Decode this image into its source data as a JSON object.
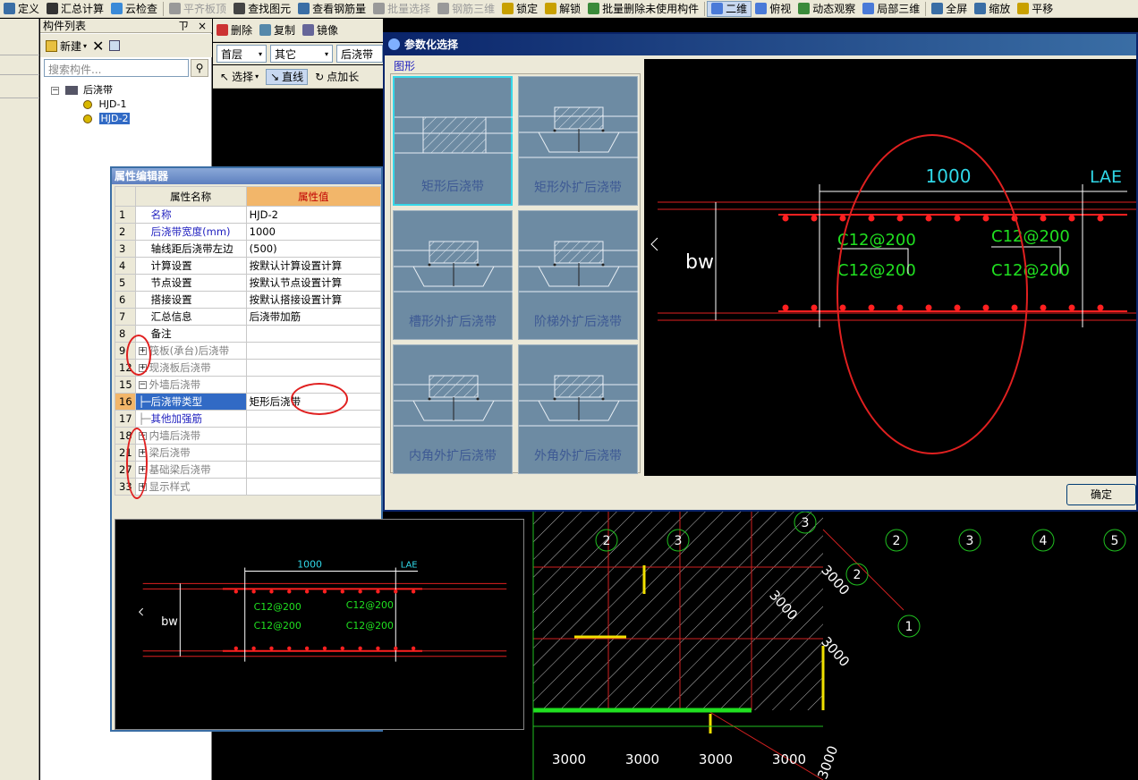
{
  "toolbar": {
    "items": [
      {
        "label": "定义",
        "icon": "define-icon",
        "disabled": false
      },
      {
        "label": "汇总计算",
        "icon": "sigma-icon",
        "disabled": false
      },
      {
        "label": "云检查",
        "icon": "cloud-check-icon",
        "disabled": false
      },
      {
        "label": "平齐板顶",
        "icon": "align-top-icon",
        "disabled": true
      },
      {
        "label": "查找图元",
        "icon": "find-icon",
        "disabled": false
      },
      {
        "label": "查看钢筋量",
        "icon": "rebar-view-icon",
        "disabled": false
      },
      {
        "label": "批量选择",
        "icon": "batch-select-icon",
        "disabled": true
      },
      {
        "label": "钢筋三维",
        "icon": "rebar-3d-icon",
        "disabled": true
      },
      {
        "label": "锁定",
        "icon": "lock-icon",
        "disabled": false
      },
      {
        "label": "解锁",
        "icon": "unlock-icon",
        "disabled": false
      },
      {
        "label": "批量删除未使用构件",
        "icon": "batch-delete-icon",
        "disabled": false
      },
      {
        "label": "二维",
        "icon": "view-2d-icon",
        "disabled": false,
        "pressed": true
      },
      {
        "label": "俯视",
        "icon": "top-view-icon",
        "disabled": false
      },
      {
        "label": "动态观察",
        "icon": "orbit-icon",
        "disabled": false
      },
      {
        "label": "局部三维",
        "icon": "local-3d-icon",
        "disabled": false
      },
      {
        "label": "全屏",
        "icon": "fullscreen-icon",
        "disabled": false
      },
      {
        "label": "缩放",
        "icon": "zoom-icon",
        "disabled": false
      },
      {
        "label": "平移",
        "icon": "pan-icon",
        "disabled": false
      }
    ]
  },
  "component_panel": {
    "title": "构件列表",
    "pin": "ㄗ",
    "close": "×",
    "new_label": "新建",
    "search_placeholder": "搜索构件...",
    "tree_root": "后浇带",
    "tree_children": [
      "HJD-1",
      "HJD-2"
    ]
  },
  "main_bars": {
    "delete_label": "删除",
    "copy_label": "复制",
    "mirror_label": "镜像",
    "floor": "首层",
    "category": "其它",
    "type": "后浇带",
    "select_label": "选择",
    "line_label": "直线",
    "point_extend_label": "点加长"
  },
  "property_editor": {
    "title": "属性编辑器",
    "col_name": "属性名称",
    "col_value": "属性值",
    "rows": [
      {
        "num": "1",
        "name": "名称",
        "value": "HJD-2",
        "style": "blue",
        "expander": ""
      },
      {
        "num": "2",
        "name": "后浇带宽度(mm)",
        "value": "1000",
        "style": "blue",
        "expander": ""
      },
      {
        "num": "3",
        "name": "轴线距后浇带左边",
        "value": "(500)",
        "style": "",
        "expander": ""
      },
      {
        "num": "4",
        "name": "计算设置",
        "value": "按默认计算设置计算",
        "style": "",
        "expander": ""
      },
      {
        "num": "5",
        "name": "节点设置",
        "value": "按默认节点设置计算",
        "style": "",
        "expander": ""
      },
      {
        "num": "6",
        "name": "搭接设置",
        "value": "按默认搭接设置计算",
        "style": "",
        "expander": ""
      },
      {
        "num": "7",
        "name": "汇总信息",
        "value": "后浇带加筋",
        "style": "",
        "expander": ""
      },
      {
        "num": "8",
        "name": "备注",
        "value": "",
        "style": "",
        "expander": ""
      },
      {
        "num": "9",
        "name": "筏板(承台)后浇带",
        "value": "",
        "style": "gray",
        "expander": "+"
      },
      {
        "num": "12",
        "name": "现浇板后浇带",
        "value": "",
        "style": "gray",
        "expander": "+"
      },
      {
        "num": "15",
        "name": "外墙后浇带",
        "value": "",
        "style": "gray",
        "expander": "-"
      },
      {
        "num": "16",
        "name": "后浇带类型",
        "value": "矩形后浇带",
        "style": "blue-sel",
        "expander": ""
      },
      {
        "num": "17",
        "name": "其他加强筋",
        "value": "",
        "style": "blue-bold",
        "expander": ""
      },
      {
        "num": "18",
        "name": "内墙后浇带",
        "value": "",
        "style": "gray",
        "expander": "+"
      },
      {
        "num": "21",
        "name": "梁后浇带",
        "value": "",
        "style": "gray",
        "expander": "+"
      },
      {
        "num": "27",
        "name": "基础梁后浇带",
        "value": "",
        "style": "gray",
        "expander": "+"
      },
      {
        "num": "33",
        "name": "显示样式",
        "value": "",
        "style": "gray",
        "expander": "+"
      }
    ]
  },
  "preview_small": {
    "width_label": "1000",
    "lae_label": "LAE",
    "bw_label": "bw",
    "rebar_labels": [
      "C12@200",
      "C12@200",
      "C12@200",
      "C12@200"
    ]
  },
  "param_dialog": {
    "title": "参数化选择",
    "group_label": "图形",
    "shapes": [
      {
        "label": "矩形后浇带",
        "selected": true
      },
      {
        "label": "矩形外扩后浇带",
        "selected": false
      },
      {
        "label": "槽形外扩后浇带",
        "selected": false
      },
      {
        "label": "阶梯外扩后浇带",
        "selected": false
      },
      {
        "label": "内角外扩后浇带",
        "selected": false
      },
      {
        "label": "外角外扩后浇带",
        "selected": false
      }
    ],
    "preview": {
      "width_label": "1000",
      "lae_label": "LAE",
      "bw_label": "bw",
      "rebar_labels": [
        "C12@200",
        "C12@200",
        "C12@200",
        "C12@200"
      ]
    },
    "ok_label": "确定"
  },
  "canvas": {
    "axis_labels": [
      "2",
      "3",
      "2",
      "3",
      "4",
      "5",
      "3",
      "2",
      "1"
    ],
    "dims": [
      "3000",
      "3000",
      "3000",
      "3000",
      "3000",
      "3000",
      "3000",
      "3000"
    ]
  },
  "colors": {
    "highlight_red": "#e02020",
    "rebar_red": "#ff2020",
    "cyan_text": "#30d8e8",
    "green_text": "#20e020",
    "selected_shape_border": "#36d7e8"
  }
}
